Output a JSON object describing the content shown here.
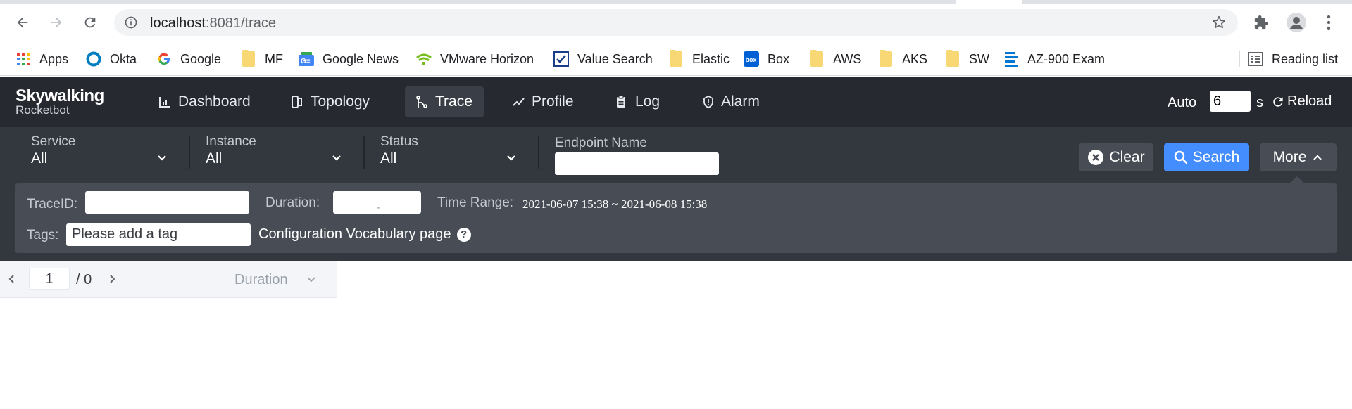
{
  "browser": {
    "url_host": "localhost",
    "url_path": ":8081/trace",
    "bookmarks": [
      {
        "label": "Apps",
        "icon": "apps-grid-icon"
      },
      {
        "label": "Okta",
        "icon": "okta-icon"
      },
      {
        "label": "Google",
        "icon": "google-icon"
      },
      {
        "label": "MF",
        "icon": "folder-icon"
      },
      {
        "label": "Google News",
        "icon": "google-news-icon"
      },
      {
        "label": "VMware Horizon",
        "icon": "vmware-icon"
      },
      {
        "label": "Value Search",
        "icon": "checkbox-icon"
      },
      {
        "label": "Elastic",
        "icon": "folder-icon"
      },
      {
        "label": "Box",
        "icon": "box-icon"
      },
      {
        "label": "AWS",
        "icon": "folder-icon"
      },
      {
        "label": "AKS",
        "icon": "folder-icon"
      },
      {
        "label": "SW",
        "icon": "folder-icon"
      },
      {
        "label": "AZ-900 Exam",
        "icon": "list-doc-icon"
      }
    ],
    "reading_list": "Reading list"
  },
  "app": {
    "logo_line1": "Skywalking",
    "logo_line2": "Rocketbot",
    "nav": [
      {
        "label": "Dashboard",
        "icon": "chart-icon"
      },
      {
        "label": "Topology",
        "icon": "topology-icon"
      },
      {
        "label": "Trace",
        "icon": "trace-icon"
      },
      {
        "label": "Profile",
        "icon": "trend-icon"
      },
      {
        "label": "Log",
        "icon": "clipboard-icon"
      },
      {
        "label": "Alarm",
        "icon": "alarm-icon"
      }
    ],
    "auto_label": "Auto",
    "auto_value": "6",
    "seconds_label": "s",
    "reload_label": "Reload"
  },
  "filters": {
    "service_label": "Service",
    "service_value": "All",
    "instance_label": "Instance",
    "instance_value": "All",
    "status_label": "Status",
    "status_value": "All",
    "endpoint_label": "Endpoint Name",
    "endpoint_value": "",
    "clear_label": "Clear",
    "search_label": "Search",
    "more_label": "More",
    "traceid_label": "TraceID:",
    "duration_label": "Duration:",
    "duration_dash": "-",
    "time_range_label": "Time Range:",
    "time_range_value": "2021-06-07 15:38 ~ 2021-06-08 15:38",
    "tags_label": "Tags:",
    "tags_placeholder": "Please add a tag",
    "vocab_label": "Configuration Vocabulary page"
  },
  "list": {
    "page": "1",
    "total": "/ 0",
    "sort_label": "Duration"
  },
  "colors": {
    "header_bg": "#262a30",
    "filter_bg": "#33373e",
    "panel_bg": "#484d55",
    "search_blue": "#448dfe"
  }
}
